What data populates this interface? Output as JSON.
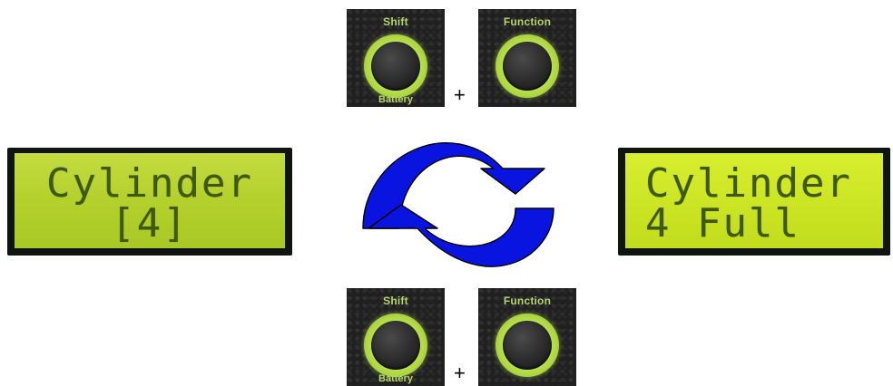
{
  "top_buttons": {
    "shift": {
      "label": "Shift",
      "sublabel": "Battery"
    },
    "plus": "+",
    "function": {
      "label": "Function"
    }
  },
  "bottom_buttons": {
    "shift": {
      "label": "Shift",
      "sublabel": "Battery"
    },
    "plus": "+",
    "function": {
      "label": "Function"
    }
  },
  "lcd_left": {
    "line1": "Cylinder",
    "line2": "[4]"
  },
  "lcd_right": {
    "line1": "Cylinder",
    "line2": "4 Full"
  },
  "colors": {
    "arrow_blue": "#0a14e0",
    "button_ring": "#b8e04a",
    "lcd_left_bg": "#b4d02c",
    "lcd_right_bg": "#cce524",
    "lcd_text": "#3f5a10"
  },
  "icons": {
    "cycle": "refresh-cycle-icon"
  }
}
